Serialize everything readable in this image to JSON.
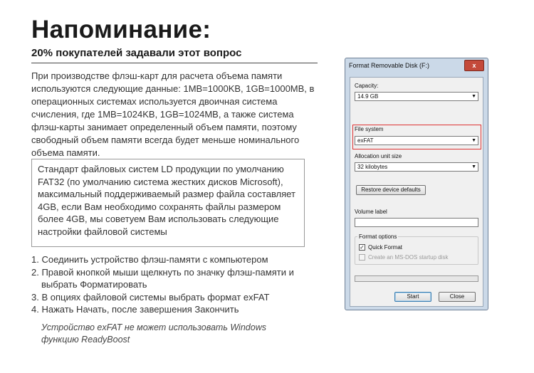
{
  "header": {
    "title": "Напоминание:",
    "subtitle": "20% покупателей задавали этот вопрос"
  },
  "intro": "При производстве флэш-карт для расчета объема памяти используются следующие данные: 1MB=1000KB, 1GB=1000MB, в операционных системах используется двоичная система счисления, где 1MB=1024KB, 1GB=1024MB, а также система флэш-карты занимает определенный объем памяти, поэтому свободный объем памяти всегда будет меньше номинального объема памяти.",
  "note": "Стандарт файловых систем LD продукции по умолчанию FAT32 (по умолчанию система жестких дисков Microsoft), максимальный поддерживаемый размер файла составляет 4GB, если Вам необходимо сохранять файлы размером более 4GB, мы советуем Вам использовать следующие настройки файловой системы",
  "steps": [
    "1. Соединить устройство флэш-памяти с компьютером",
    "2. Правой кнопкой мыши щелкнуть по значку флэш-памяти и выбрать Форматировать",
    "3. В опциях файловой системы выбрать формат exFAT",
    "4. Нажать Начать, после завершения Закончить"
  ],
  "footnote": "Устройство exFAT не может использовать Windows функцию ReadyBoost",
  "dialog": {
    "title": "Format Removable Disk (F:)",
    "close_glyph": "x",
    "capacity_label": "Capacity:",
    "capacity_value": "14.9 GB",
    "filesystem_label": "File system",
    "filesystem_value": "exFAT",
    "allocation_label": "Allocation unit size",
    "allocation_value": "32 kilobytes",
    "restore_button": "Restore device defaults",
    "volume_label": "Volume label",
    "volume_value": "",
    "format_options_label": "Format options",
    "quick_format_label": "Quick Format",
    "quick_format_checked": true,
    "msdos_label": "Create an MS-DOS startup disk",
    "msdos_checked": false,
    "start_button": "Start",
    "close_button": "Close",
    "dropdown_glyph": "▼",
    "check_glyph": "✓",
    "colors": {
      "highlight": "#dd3333",
      "close_red": "#c44a3a",
      "frame": "#cbd9e8"
    }
  }
}
